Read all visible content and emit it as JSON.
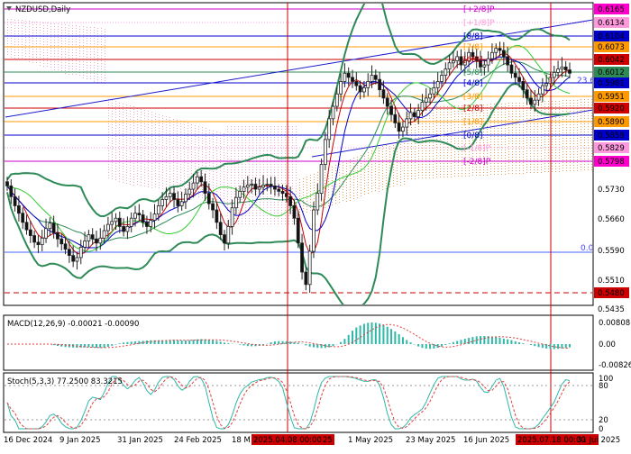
{
  "symbol_title": "NZDUSD,Daily",
  "colors": {
    "background": "#ffffff",
    "bull_candle": "#3a3a3a",
    "bear_candle": "#111111",
    "bollinger": "#2e8b57",
    "ema_red": "#cc0000",
    "kijun_blue": "#0000cc",
    "alligator_lime": "#33cc33",
    "cloud_pink": "#f0a8c8",
    "cloud_orange": "#e8a060",
    "trend_blue": "#1a1acc",
    "marker_red": "#cc0000",
    "macd_hist": "#2fb8a8",
    "macd_signal": "#e04040",
    "stoch_main": "#2fb8a8",
    "stoch_signal": "#e04040"
  },
  "price_axis": {
    "labels": [
      "0.6165",
      "0.6134",
      "0.6104",
      "0.6073",
      "0.6042",
      "0.6012",
      "0.5981",
      "0.5951",
      "0.5920",
      "0.5890",
      "0.5859",
      "0.5829",
      "0.5798",
      "0.5730",
      "0.5660",
      "0.5590",
      "0.5510",
      "0.5480",
      "0.5435"
    ],
    "badge_colors": [
      "#ff00cc",
      "#ff99dd",
      "#0000cc",
      "#ff9900",
      "#cc0000",
      "#2e8b57",
      "#0000cc",
      "#ff9900",
      "#cc0000",
      "#ff9900",
      "#0000cc",
      "#ff99dd",
      "#ff00cc",
      null,
      null,
      null,
      null,
      "#cc0000",
      null
    ]
  },
  "murrey_levels": [
    {
      "label": "[+2/8]P",
      "price": 0.6165,
      "color": "#cc00cc"
    },
    {
      "label": "[+1/8]P",
      "price": 0.6134,
      "color": "#ff99dd"
    },
    {
      "label": "[8/8]",
      "price": 0.6104,
      "color": "#0000cc"
    },
    {
      "label": "[7/8]",
      "price": 0.6073,
      "color": "#ff9900"
    },
    {
      "label": "[6/8]",
      "price": 0.6042,
      "color": "#cc0000"
    },
    {
      "label": "[5/8]",
      "price": 0.6012,
      "color": "#2e8b57"
    },
    {
      "label": "[4/8]",
      "price": 0.5981,
      "color": "#0000cc"
    },
    {
      "label": "[3/8]",
      "price": 0.5951,
      "color": "#ff9900"
    },
    {
      "label": "[2/8]",
      "price": 0.592,
      "color": "#cc0000"
    },
    {
      "label": "[1/8]",
      "price": 0.589,
      "color": "#ff9900"
    },
    {
      "label": "[0/8]",
      "price": 0.5859,
      "color": "#0000cc"
    },
    {
      "label": "[-1/8]P",
      "price": 0.5829,
      "color": "#ff99dd"
    },
    {
      "label": "[-2/8]P",
      "price": 0.5798,
      "color": "#cc00cc"
    }
  ],
  "fib_labels": {
    "upper": "23.6",
    "lower": "0.0"
  },
  "macd": {
    "header": "MACD(12,26,9) -0.00021 -0.00090",
    "axis": [
      "0.00808",
      "0.00",
      "-0.00826"
    ]
  },
  "stoch": {
    "header": "Stoch(5,3,3) 77.2500 83.3215",
    "axis": [
      "100",
      "80",
      "20",
      "0"
    ]
  },
  "date_axis": [
    "16 Dec 2024",
    "9 Jan 2025",
    "31 Jan 2025",
    "24 Feb 2025",
    "18 M",
    "2025.04.08 00:00",
    "25",
    "1 May 2025",
    "23 May 2025",
    "16 Jun 2025",
    "2025.07.18 00:00",
    "31 Jul 2025"
  ],
  "chart_data": {
    "type": "candlestick",
    "title": "NZDUSD,Daily",
    "ylim": [
      0.5435,
      0.618
    ],
    "price_path": [
      0.5738,
      0.5712,
      0.569,
      0.5672,
      0.565,
      0.5632,
      0.5618,
      0.5602,
      0.5596,
      0.5612,
      0.5635,
      0.5648,
      0.5625,
      0.561,
      0.5598,
      0.5585,
      0.557,
      0.5556,
      0.5565,
      0.559,
      0.5605,
      0.562,
      0.561,
      0.56,
      0.5612,
      0.563,
      0.5645,
      0.5652,
      0.566,
      0.564,
      0.5628,
      0.564,
      0.566,
      0.5672,
      0.5668,
      0.565,
      0.564,
      0.5655,
      0.567,
      0.569,
      0.5705,
      0.5712,
      0.572,
      0.5705,
      0.569,
      0.57,
      0.5718,
      0.573,
      0.5745,
      0.576,
      0.5748,
      0.572,
      0.5695,
      0.568,
      0.565,
      0.562,
      0.56,
      0.564,
      0.5685,
      0.571,
      0.5725,
      0.5735,
      0.574,
      0.5742,
      0.573,
      0.5735,
      0.574,
      0.5742,
      0.5738,
      0.573,
      0.5725,
      0.572,
      0.5712,
      0.569,
      0.566,
      0.56,
      0.553,
      0.55,
      0.558,
      0.568,
      0.572,
      0.579,
      0.585,
      0.59,
      0.593,
      0.596,
      0.599,
      0.601,
      0.6,
      0.599,
      0.598,
      0.5965,
      0.5975,
      0.599,
      0.6005,
      0.5995,
      0.597,
      0.595,
      0.593,
      0.591,
      0.589,
      0.587,
      0.588,
      0.59,
      0.5915,
      0.5905,
      0.592,
      0.594,
      0.595,
      0.596,
      0.5975,
      0.599,
      0.6005,
      0.602,
      0.6035,
      0.604,
      0.605,
      0.603,
      0.604,
      0.606,
      0.605,
      0.604,
      0.6025,
      0.603,
      0.6045,
      0.606,
      0.607,
      0.6065,
      0.605,
      0.603,
      0.601,
      0.6,
      0.599,
      0.597,
      0.595,
      0.5935,
      0.5945,
      0.596,
      0.598,
      0.5985,
      0.6,
      0.6012,
      0.602,
      0.6025,
      0.6018,
      0.601
    ]
  }
}
